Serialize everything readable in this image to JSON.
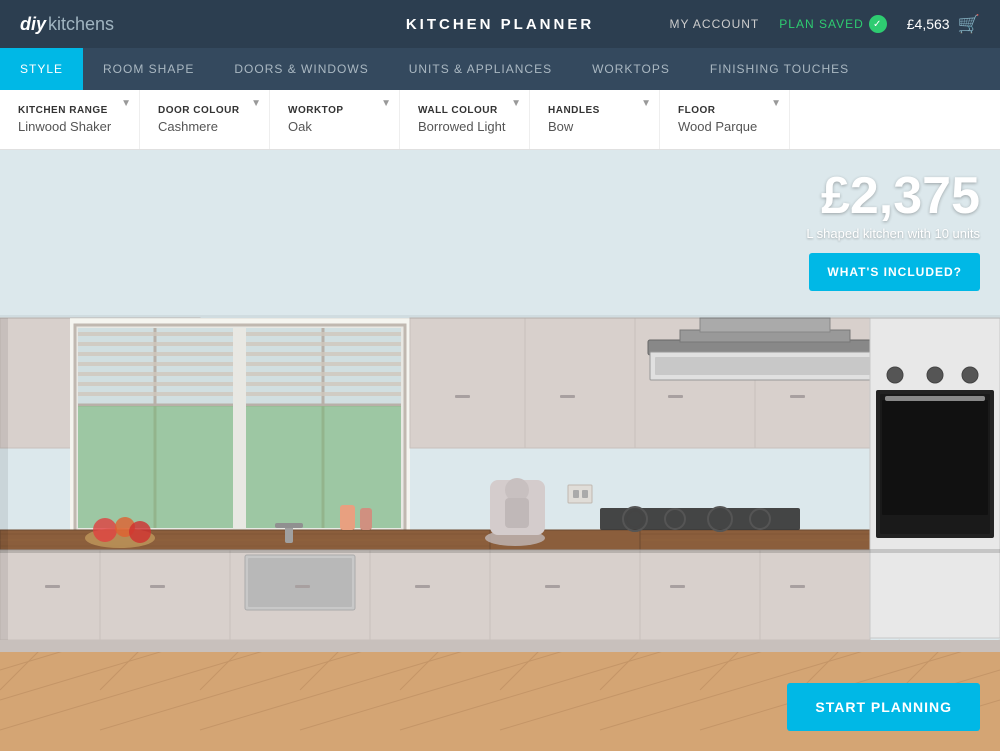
{
  "header": {
    "logo_diy": "diy",
    "logo_kitchens": "kitchens",
    "title": "KITCHEN PLANNER",
    "my_account": "MY ACCOUNT",
    "plan_saved": "PLAN SAVED",
    "price": "£4,563",
    "cart_icon": "🛒"
  },
  "nav": {
    "tabs": [
      {
        "label": "STYLE",
        "active": true
      },
      {
        "label": "ROOM SHAPE",
        "active": false
      },
      {
        "label": "DOORS & WINDOWS",
        "active": false
      },
      {
        "label": "UNITS & APPLIANCES",
        "active": false
      },
      {
        "label": "WORKTOPS",
        "active": false
      },
      {
        "label": "FINISHING TOUCHES",
        "active": false
      }
    ]
  },
  "options": [
    {
      "label": "KITCHEN RANGE",
      "value": "Linwood Shaker"
    },
    {
      "label": "DOOR COLOUR",
      "value": "Cashmere"
    },
    {
      "label": "WORKTOP",
      "value": "Oak"
    },
    {
      "label": "WALL COLOUR",
      "value": "Borrowed Light"
    },
    {
      "label": "HANDLES",
      "value": "Bow"
    },
    {
      "label": "FLOOR",
      "value": "Wood Parque"
    }
  ],
  "price_panel": {
    "price": "£2,375",
    "description": "L shaped kitchen with 10 units",
    "whats_included_btn": "WHAT'S INCLUDED?"
  },
  "start_planning": {
    "btn_label": "START PLANNING"
  }
}
